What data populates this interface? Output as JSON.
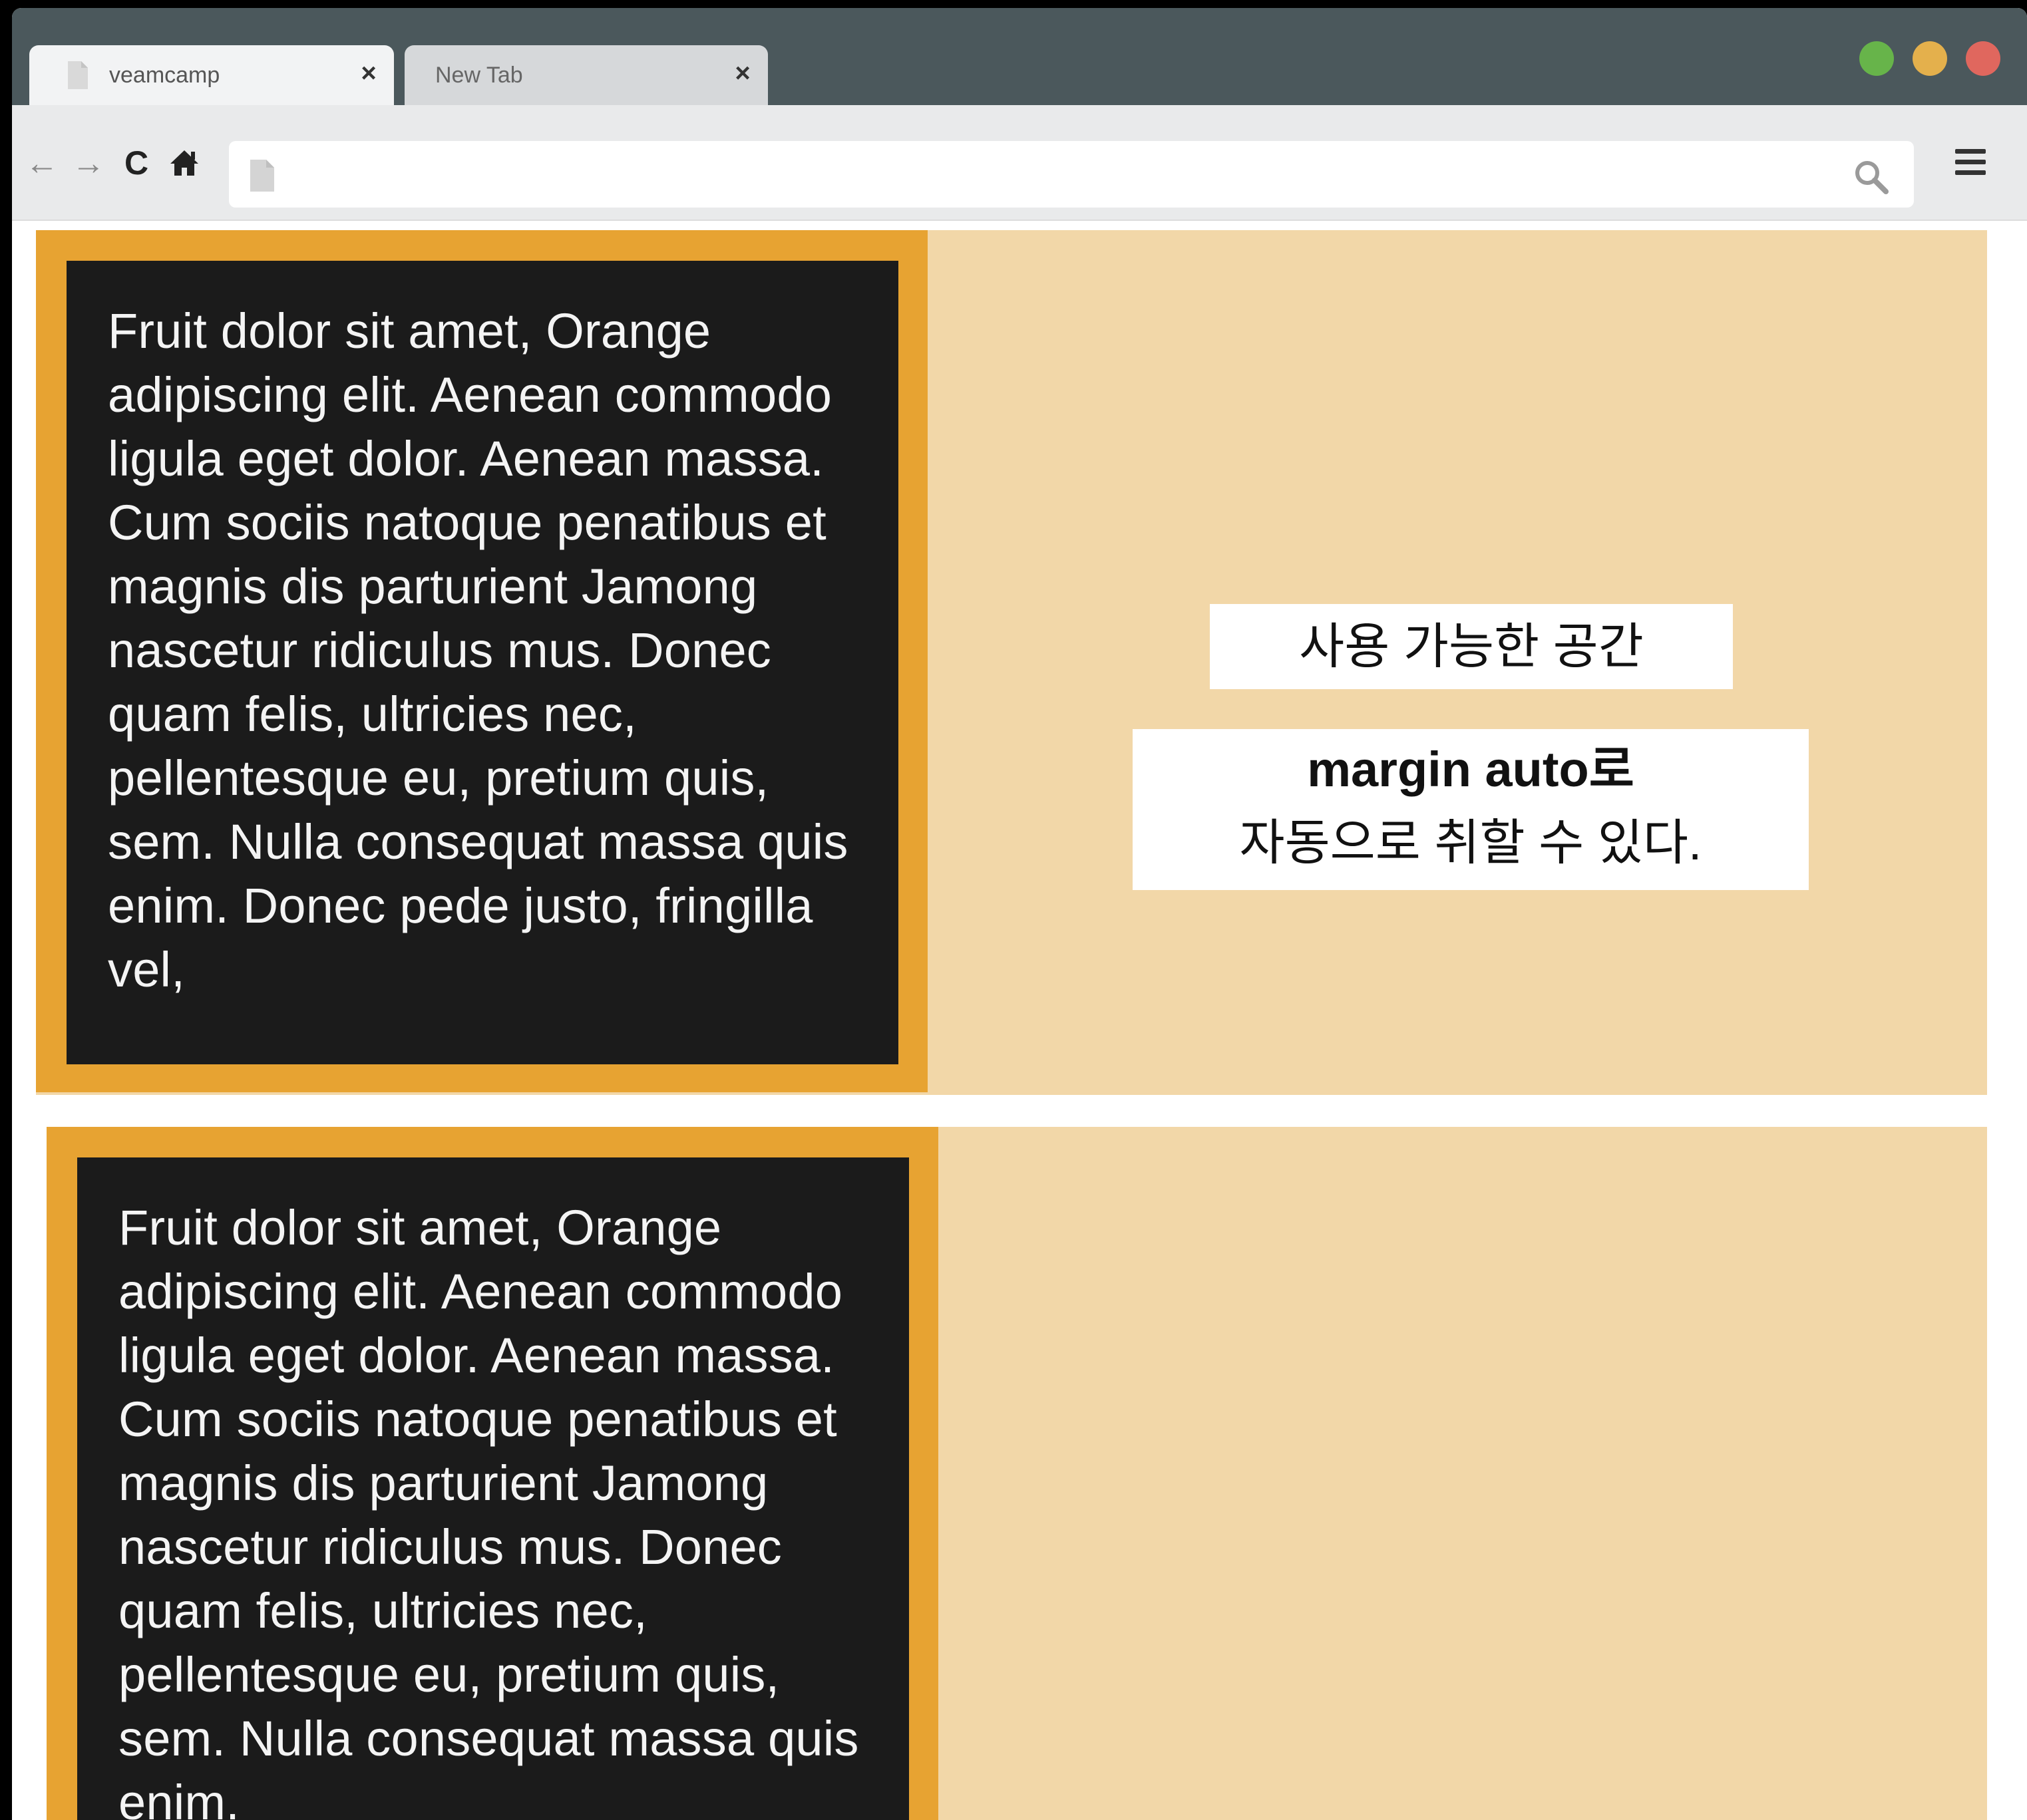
{
  "browser": {
    "tabs": [
      {
        "title": "veamcamp",
        "close": "×"
      },
      {
        "title": "New Tab",
        "close": "×"
      }
    ],
    "nav": {
      "back": "←",
      "forward": "→",
      "reload": "C",
      "menu_icon": "hamburger-icon"
    },
    "address": {
      "value": "",
      "placeholder": ""
    },
    "colors": {
      "titlebar": "#4b585c",
      "traffic_green": "#67b44a",
      "traffic_yellow": "#e4b04c",
      "traffic_red": "#e0675e"
    }
  },
  "content": {
    "rows": [
      {
        "text": "Fruit dolor sit amet, Orange adipiscing elit. Aenean commodo ligula eget dolor. Aenean massa. Cum sociis natoque penatibus et magnis dis parturient Jamong nascetur ridiculus mus. Donec quam felis, ultricies nec, pellentesque eu, pretium quis, sem. Nulla consequat massa quis enim. Donec pede justo, fringilla vel,"
      },
      {
        "text": "Fruit dolor sit amet, Orange adipiscing elit. Aenean commodo ligula eget dolor. Aenean massa. Cum sociis natoque penatibus et magnis dis parturient Jamong nascetur ridiculus mus. Donec quam felis, ultricies nec, pellentesque eu, pretium quis, sem. Nulla consequat massa quis enim."
      }
    ],
    "labels": {
      "available_space": "사용 가능한 공간",
      "margin_auto_line1": "margin auto로",
      "margin_auto_line2": "자동으로 취할 수 있다."
    },
    "colors": {
      "orange": "#e7a332",
      "light_orange": "#f2d7a8",
      "dark_box": "#1b1b1b"
    }
  }
}
